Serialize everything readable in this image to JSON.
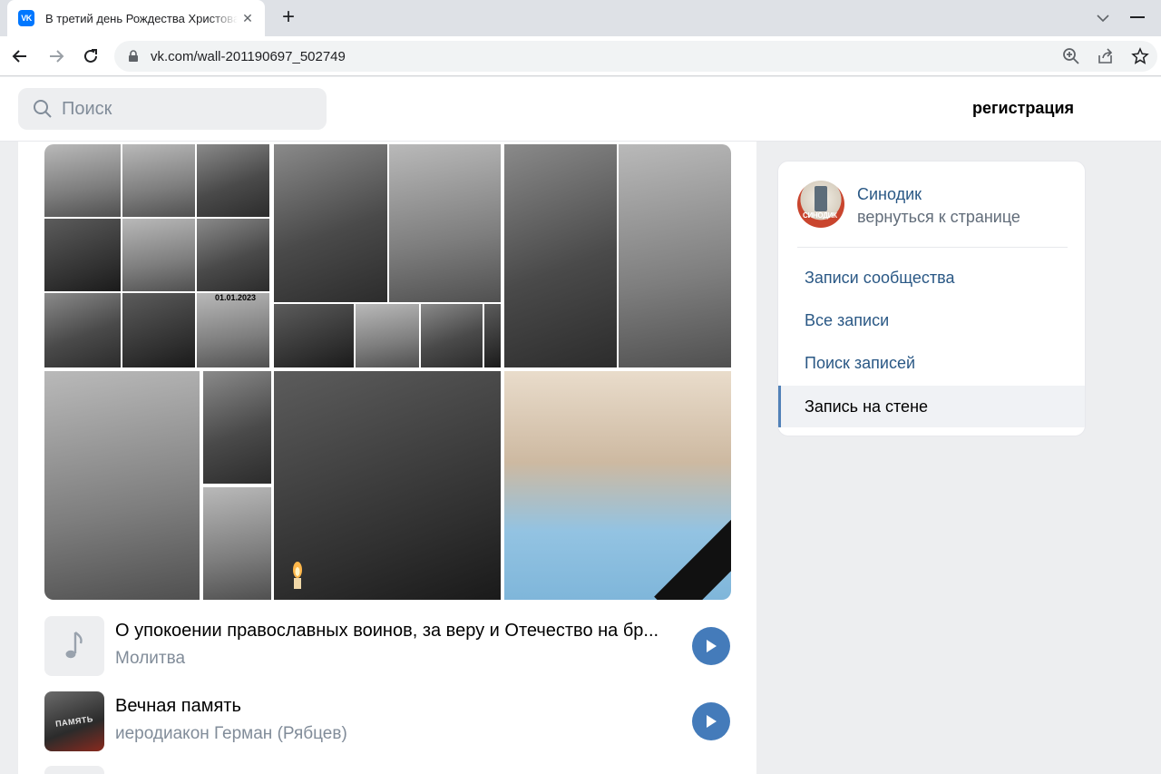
{
  "browser": {
    "tab_title": "В третий день Рождества Христова",
    "favicon_text": "VK",
    "url": "vk.com/wall-201190697_502749"
  },
  "header": {
    "search_placeholder": "Поиск",
    "register_label": "регистрация"
  },
  "post": {
    "gallery_stamp": "01.01.2023",
    "audios": [
      {
        "title": "О упокоении православных воинов, за веру и Отечество на бр...",
        "artist": "Молитва"
      },
      {
        "title": "Вечная память",
        "artist": "иеродиакон Герман (Рябцев)",
        "cover_text": "ПАМЯТЬ"
      }
    ]
  },
  "sidebar": {
    "owner_name": "Синодик",
    "back_label": "вернуться к странице",
    "avatar_text": "СИНОДИК",
    "items": [
      {
        "label": "Записи сообщества"
      },
      {
        "label": "Все записи"
      },
      {
        "label": "Поиск записей"
      },
      {
        "label": "Запись на стене",
        "active": true
      }
    ]
  },
  "colors": {
    "vk_link": "#2a5885",
    "play_button": "#447bba",
    "page_bg": "#edeef0"
  }
}
